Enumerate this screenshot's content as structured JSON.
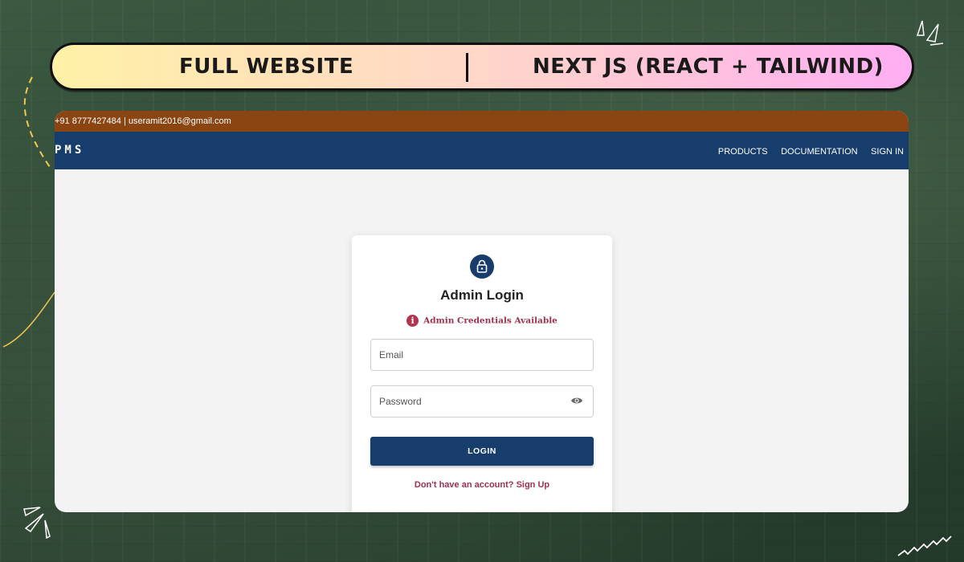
{
  "banner": {
    "left_text": "FULL WEBSITE",
    "right_text": "NEXT JS (REACT + TAILWIND)"
  },
  "topbar": {
    "contact": "+91 8777427484 | useramit2016@gmail.com"
  },
  "navbar": {
    "brand": "PMS",
    "links": [
      "PRODUCTS",
      "DOCUMENTATION",
      "SIGN IN"
    ]
  },
  "login": {
    "icon": "lock-icon",
    "title": "Admin Login",
    "notice": "Admin Credentials Available",
    "notice_icon": "info-icon",
    "email_placeholder": "Email",
    "email_value": "",
    "password_placeholder": "Password",
    "password_value": "",
    "password_toggle_icon": "eye-icon",
    "button_label": "LOGIN",
    "signup_text": "Don't have an account? Sign Up"
  },
  "colors": {
    "navbar": "#163d6b",
    "topbar": "#8b4513",
    "accent_text": "#a0304d",
    "page_bg": "#f3f3f3"
  }
}
